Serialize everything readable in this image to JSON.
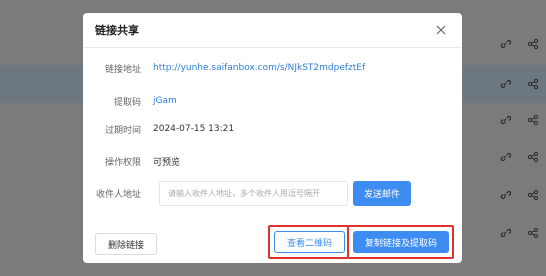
{
  "dialog": {
    "title": "链接共享",
    "link_label": "链接地址",
    "link_value": "http://yunhe.saifanbox.com/s/NJkST2mdpefztEf",
    "code_label": "提取码",
    "code_value": "jGam",
    "expire_label": "过期时间",
    "expire_value": "2024-07-15 13:21",
    "permission_label": "操作权限",
    "permission_value": "可预览",
    "email_label": "收件人地址",
    "email_placeholder": "请输入收件人地址，多个收件人用逗号隔开",
    "send_label": "发送邮件",
    "delete_label": "删除链接",
    "qr_label": "查看二维码",
    "copy_label": "复制链接及提取码"
  },
  "colors": {
    "primary": "#3d8cf2",
    "link": "#2f7fd8",
    "highlight_border": "#e03131"
  }
}
